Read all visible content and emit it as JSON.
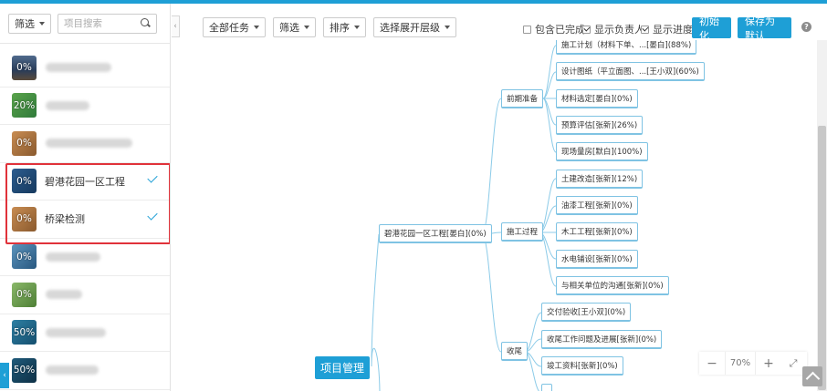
{
  "left_panel": {
    "filter_label": "筛选",
    "search_placeholder": "项目搜索",
    "projects": [
      {
        "progress": "0%",
        "name": "",
        "selected": false
      },
      {
        "progress": "20%",
        "name": "",
        "selected": false
      },
      {
        "progress": "0%",
        "name": "",
        "selected": false
      },
      {
        "progress": "0%",
        "name": "碧港花园一区工程",
        "selected": true
      },
      {
        "progress": "0%",
        "name": "桥梁检测",
        "selected": true
      },
      {
        "progress": "0%",
        "name": "",
        "selected": false
      },
      {
        "progress": "0%",
        "name": "",
        "selected": false
      },
      {
        "progress": "50%",
        "name": "",
        "selected": false
      },
      {
        "progress": "50%",
        "name": "",
        "selected": false
      }
    ]
  },
  "toolbar": {
    "all_tasks": "全部任务",
    "filter": "筛选",
    "sort": "排序",
    "expand_level": "选择展开层级",
    "include_completed": "包含已完成",
    "include_completed_checked": false,
    "show_owner": "显示负责人",
    "show_owner_checked": true,
    "show_progress": "显示进度",
    "show_progress_checked": true,
    "initialize": "初始化",
    "save_default": "保存为默认",
    "help": "?"
  },
  "mindmap": {
    "root": "项目管理",
    "project": "碧港花园一区工程[晏白](0%)",
    "phases": [
      {
        "label": "前期准备",
        "tasks": [
          "施工计划（材料下单、...[晏白](88%)",
          "设计图纸（平立面图、...[王小双](60%)",
          "材料选定[晏白](0%)",
          "预算评估[张新](26%)",
          "现场量房[默白](100%)"
        ]
      },
      {
        "label": "施工过程",
        "tasks": [
          "土建改造[张新](12%)",
          "油漆工程[张新](0%)",
          "木工工程[张新](0%)",
          "水电铺设[张新](0%)",
          "与相关单位的沟通[张新](0%)"
        ]
      },
      {
        "label": "收尾",
        "tasks": [
          "交付验收[王小双](0%)",
          "收尾工作问题及进展[张新](0%)",
          "竣工资料[张新](0%)"
        ]
      }
    ]
  },
  "zoom": {
    "minus": "−",
    "value": "70%",
    "plus": "+",
    "fit": "⤢"
  },
  "colors": {
    "accent": "#1e9fd6",
    "highlight_border": "#e0323a",
    "node_border": "#7fc3e3"
  }
}
